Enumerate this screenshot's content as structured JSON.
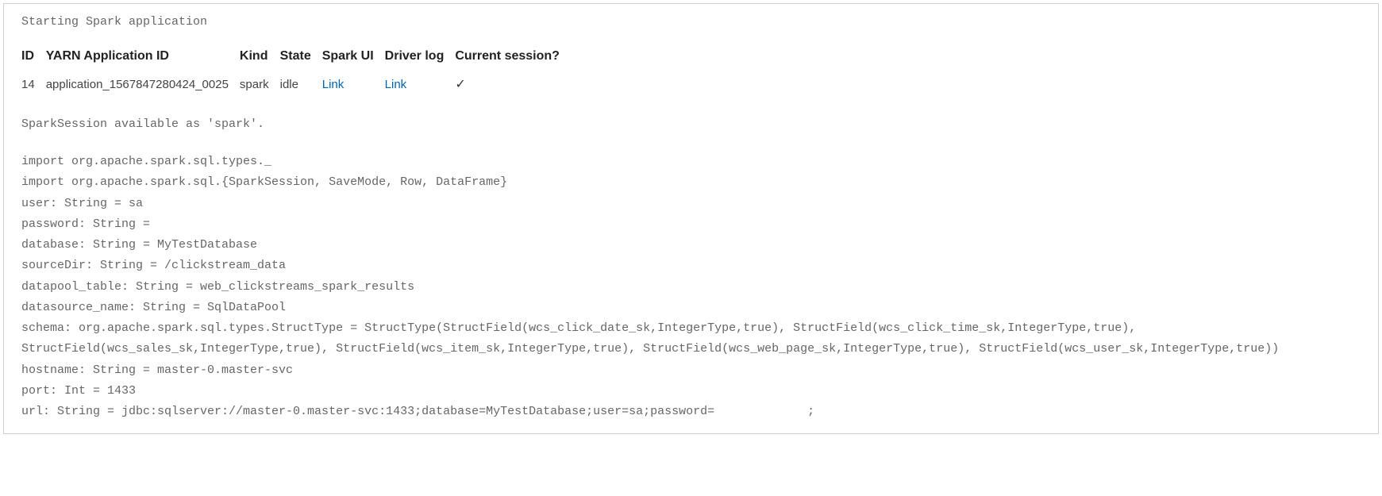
{
  "status_text": "Starting Spark application",
  "table": {
    "headers": {
      "id": "ID",
      "yarn_app_id": "YARN Application ID",
      "kind": "Kind",
      "state": "State",
      "spark_ui": "Spark UI",
      "driver_log": "Driver log",
      "current_session": "Current session?"
    },
    "row": {
      "id": "14",
      "yarn_app_id": "application_1567847280424_0025",
      "kind": "spark",
      "state": "idle",
      "spark_ui_link": "Link",
      "driver_log_link": "Link",
      "current_session_mark": "✓"
    }
  },
  "session_msg": "SparkSession available as 'spark'.",
  "code_lines": [
    "import org.apache.spark.sql.types._",
    "import org.apache.spark.sql.{SparkSession, SaveMode, Row, DataFrame}",
    "user: String = sa",
    "password: String =",
    "database: String = MyTestDatabase",
    "sourceDir: String = /clickstream_data",
    "datapool_table: String = web_clickstreams_spark_results",
    "datasource_name: String = SqlDataPool",
    "schema: org.apache.spark.sql.types.StructType = StructType(StructField(wcs_click_date_sk,IntegerType,true), StructField(wcs_click_time_sk,IntegerType,true), StructField(wcs_sales_sk,IntegerType,true), StructField(wcs_item_sk,IntegerType,true), StructField(wcs_web_page_sk,IntegerType,true), StructField(wcs_user_sk,IntegerType,true))",
    "hostname: String = master-0.master-svc",
    "port: Int = 1433",
    "url: String = jdbc:sqlserver://master-0.master-svc:1433;database=MyTestDatabase;user=sa;password=             ;"
  ]
}
